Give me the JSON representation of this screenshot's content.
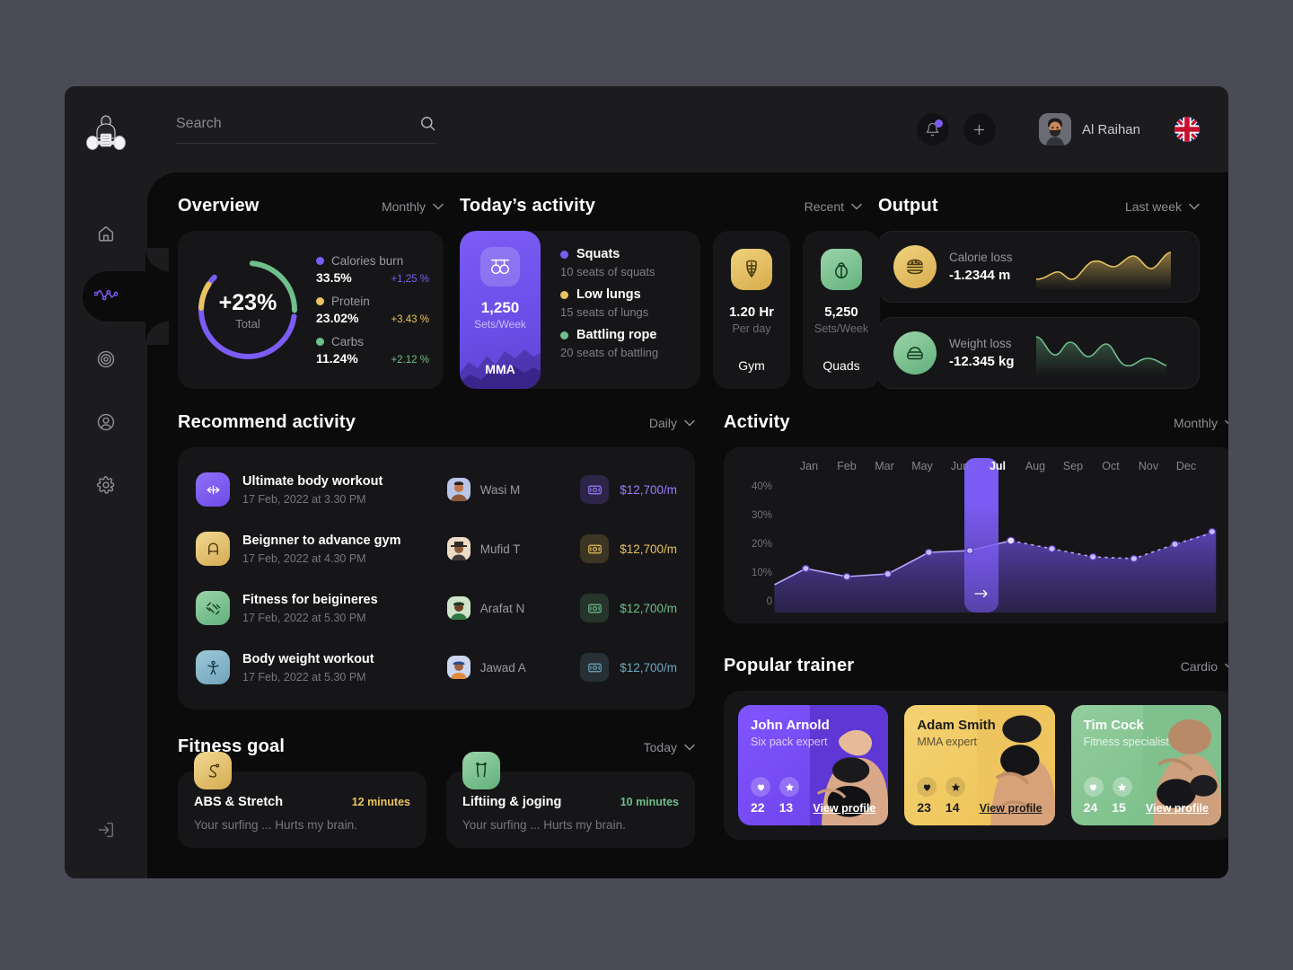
{
  "topbar": {
    "search_placeholder": "Search",
    "search_value": "",
    "user_name": "Al Raihan",
    "flag": "uk-flag"
  },
  "sidebar": {
    "items": [
      {
        "name": "home",
        "active": false
      },
      {
        "name": "analytics",
        "active": true
      },
      {
        "name": "target",
        "active": false
      },
      {
        "name": "profile",
        "active": false
      },
      {
        "name": "settings",
        "active": false
      }
    ],
    "logout": "logout"
  },
  "overview": {
    "title": "Overview",
    "filter": "Monthly",
    "total_value": "+23%",
    "total_label": "Total",
    "legend": [
      {
        "label": "Calories burn",
        "value": "33.5%",
        "delta": "+1,25 %",
        "color": "#7b5cf5"
      },
      {
        "label": "Protein",
        "value": "23.02%",
        "delta": "+3.43 %",
        "color": "#e9c35f"
      },
      {
        "label": "Carbs",
        "value": "11.24%",
        "delta": "+2.12 %",
        "color": "#6fbf8a"
      }
    ]
  },
  "today": {
    "title": "Today’s activity",
    "filter": "Recent",
    "featured": {
      "value": "1,250",
      "unit": "Sets/Week",
      "name": "MMA",
      "icon": "rings-icon"
    },
    "items": [
      {
        "label": "Squats",
        "sub": "10 seats of squats",
        "color": "#7b5cf5"
      },
      {
        "label": "Low lungs",
        "sub": "15 seats of lungs",
        "color": "#e9c35f"
      },
      {
        "label": "Battling rope",
        "sub": "20 seats of battling",
        "color": "#6fbf8a"
      }
    ],
    "stats": [
      {
        "value": "1.20 Hr",
        "sub": "Per day",
        "name": "Gym",
        "icon": "abs-icon",
        "color": "#e9c35f"
      },
      {
        "value": "5,250",
        "sub": "Sets/Week",
        "name": "Quads",
        "icon": "kettlebell-icon",
        "color": "#6fbf8a"
      }
    ]
  },
  "output": {
    "title": "Output",
    "filter": "Last week",
    "items": [
      {
        "name": "Calorie loss",
        "value": "-1.2344 m",
        "color": "#e9c35f",
        "icon": "burger-icon"
      },
      {
        "name": "Weight loss",
        "value": "-12.345 kg",
        "color": "#6fbf8a",
        "icon": "scale-icon"
      }
    ]
  },
  "recommend": {
    "title": "Recommend activity",
    "filter": "Daily",
    "rows": [
      {
        "title": "Ultimate body workout",
        "date": "17 Feb, 2022 at 3.30 PM",
        "person": "Wasi M",
        "price": "$12,700/m",
        "color": "#7b5cf5",
        "icon": "stretch-icon"
      },
      {
        "title": "Beignner to advance gym",
        "date": "17 Feb, 2022 at 4.30 PM",
        "person": "Mufid T",
        "price": "$12,700/m",
        "color": "#e9c35f",
        "icon": "magnet-icon"
      },
      {
        "title": "Fitness for beigineres",
        "date": "17 Feb, 2022 at 5.30 PM",
        "person": "Arafat N",
        "price": "$12,700/m",
        "color": "#6fbf8a",
        "icon": "dumbbell-icon"
      },
      {
        "title": "Body weight workout",
        "date": "17 Feb, 2022 at 5.30 PM",
        "person": "Jawad A",
        "price": "$12,700/m",
        "color": "#6fa8bf",
        "icon": "bodyweight-icon"
      }
    ]
  },
  "goals": {
    "title": "Fitness goal",
    "filter": "Today",
    "items": [
      {
        "title": "ABS & Stretch",
        "minutes": "12 minutes",
        "desc": "Your surfing ... Hurts my brain.",
        "color": "#e9c35f",
        "icon": "rope-icon"
      },
      {
        "title": "Liftiing & joging",
        "minutes": "10 minutes",
        "desc": "Your surfing ... Hurts my brain.",
        "color": "#6fbf8a",
        "icon": "legs-icon"
      }
    ]
  },
  "activity": {
    "title": "Activity",
    "filter": "Monthly"
  },
  "trainers": {
    "title": "Popular trainer",
    "filter": "Cardio",
    "link_label": "View profile",
    "cards": [
      {
        "name": "John Arnold",
        "role": "Six pack expert",
        "likes": "22",
        "stars": "13",
        "color": "#7b4ff0",
        "text": "#ffffff"
      },
      {
        "name": "Adam Smith",
        "role": "MMA expert",
        "likes": "23",
        "stars": "14",
        "color": "#f2cb63",
        "text": "#1c1c1e"
      },
      {
        "name": "Tim Cock",
        "role": "Fitness specialist",
        "likes": "24",
        "stars": "15",
        "color": "#81c48e",
        "text": "#ffffff"
      }
    ]
  },
  "chart_data": {
    "type": "area",
    "title": "Activity",
    "xlabel": "",
    "ylabel": "",
    "categories": [
      "Jan",
      "Feb",
      "Mar",
      "May",
      "Jun",
      "Jul",
      "Aug",
      "Sep",
      "Oct",
      "Nov",
      "Dec"
    ],
    "values": [
      17,
      14,
      15.5,
      23,
      23.5,
      27,
      24,
      21.5,
      21,
      26.5,
      30.5
    ],
    "selected_category": "Jul",
    "ylim": [
      0,
      40
    ],
    "yticks": [
      "40%",
      "30%",
      "20%",
      "10%",
      "0"
    ],
    "ytick_values": [
      40,
      30,
      20,
      10,
      0
    ],
    "grid": false,
    "legend": "none",
    "line_color": "#a98cff",
    "fill_color": "#6b4fd8",
    "dashed_from": "Jul"
  },
  "sparklines": {
    "calorie_loss": {
      "type": "area",
      "color": "#e9c35f",
      "values": [
        18,
        16,
        24,
        19,
        17,
        34,
        28,
        40,
        31,
        26,
        44
      ]
    },
    "weight_loss": {
      "type": "line",
      "color": "#6fbf8a",
      "values": [
        40,
        26,
        21,
        38,
        24,
        33,
        22,
        14,
        9,
        17,
        13
      ]
    }
  },
  "donut_data": {
    "type": "pie",
    "labels": [
      "Calories burn",
      "Carbs",
      "Protein"
    ],
    "values": [
      63,
      25,
      10
    ],
    "colors": [
      "#7b5cf5",
      "#6fbf8a",
      "#e9c35f"
    ]
  }
}
